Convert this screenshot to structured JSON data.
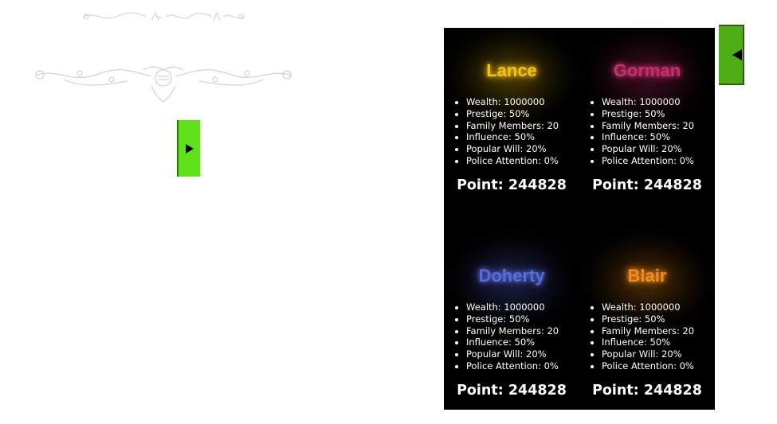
{
  "players": [
    {
      "name": "Lance",
      "color": "#f2c21a",
      "stats": [
        "Wealth: 1000000",
        "Prestige: 50%",
        "Family Members: 20",
        "Influence: 50%",
        "Popular Will: 20%",
        "Police Attention: 0%"
      ],
      "points": "Point: 244828"
    },
    {
      "name": "Gorman",
      "color": "#c2306b",
      "stats": [
        "Wealth: 1000000",
        "Prestige: 50%",
        "Family Members: 20",
        "Influence: 50%",
        "Popular Will: 20%",
        "Police Attention: 0%"
      ],
      "points": "Point: 244828"
    },
    {
      "name": "Doherty",
      "color": "#5a6ad8",
      "stats": [
        "Wealth: 1000000",
        "Prestige: 50%",
        "Family Members: 20",
        "Influence: 50%",
        "Popular Will: 20%",
        "Police Attention: 0%"
      ],
      "points": "Point: 244828"
    },
    {
      "name": "Blair",
      "color": "#f08c1c",
      "stats": [
        "Wealth: 1000000",
        "Prestige: 50%",
        "Family Members: 20",
        "Influence: 50%",
        "Popular Will: 20%",
        "Police Attention: 0%"
      ],
      "points": "Point: 244828"
    }
  ],
  "controls": {
    "left_panel_toggle_icon": "play-right-icon",
    "right_panel_toggle_icon": "play-left-icon",
    "accent": "#5fe11b"
  }
}
